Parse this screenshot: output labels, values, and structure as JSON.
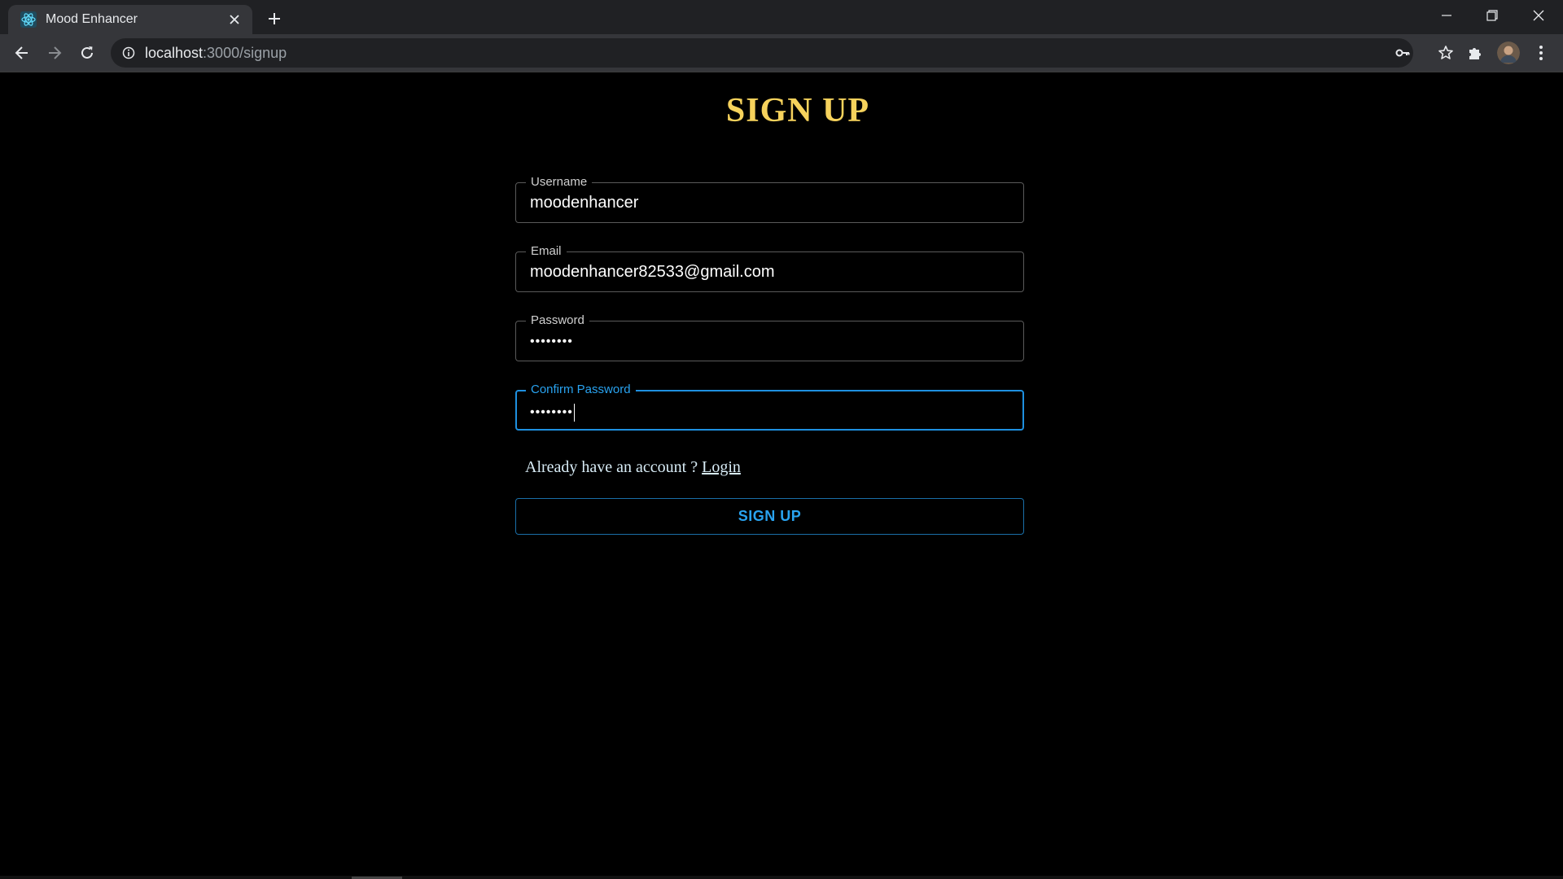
{
  "browser": {
    "tab_title": "Mood Enhancer",
    "url_host": "localhost",
    "url_path": ":3000/signup",
    "icons": {
      "favicon": "react-logo-icon",
      "close": "close-icon",
      "new_tab": "plus-icon",
      "back": "arrow-left-icon",
      "forward": "arrow-right-icon",
      "reload": "reload-icon",
      "info": "info-icon",
      "key": "key-icon",
      "bookmark": "star-icon",
      "extensions": "puzzle-icon",
      "menu": "kebab-menu-icon"
    }
  },
  "page": {
    "title": "SIGN UP",
    "fields": {
      "username": {
        "label": "Username",
        "value": "moodenhancer"
      },
      "email": {
        "label": "Email",
        "value": "moodenhancer82533@gmail.com"
      },
      "password": {
        "label": "Password",
        "value": "••••••••"
      },
      "confirm_password": {
        "label": "Confirm Password",
        "value": "••••••••"
      }
    },
    "account_prompt": "Already have an account ?",
    "login_link": "Login",
    "signup_button": "SIGN UP"
  },
  "colors": {
    "title": "#f6d25c",
    "accent": "#29a3f0",
    "background": "#000000"
  }
}
